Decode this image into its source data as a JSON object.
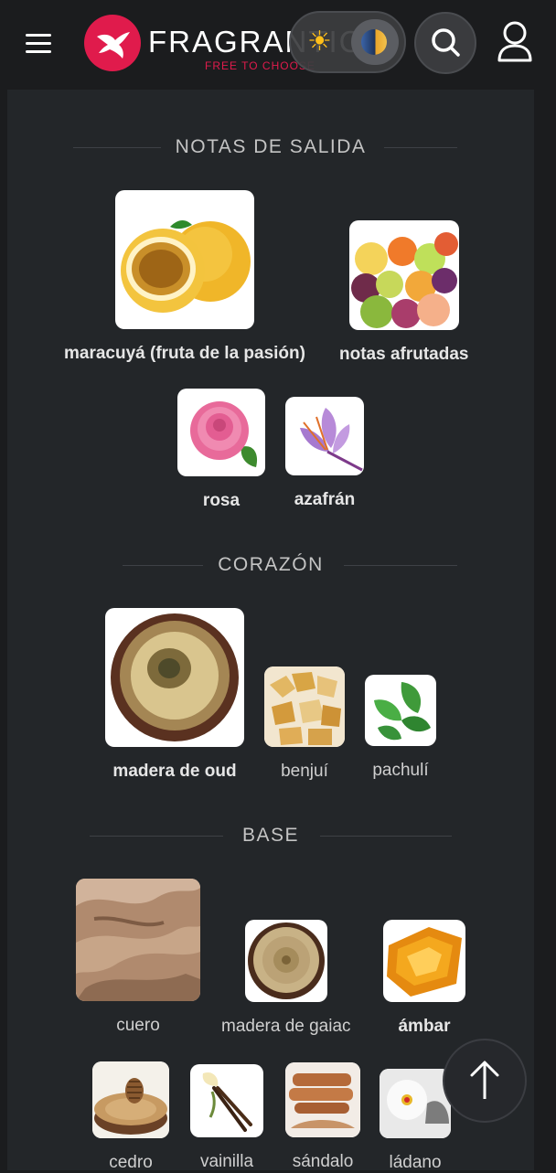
{
  "header": {
    "logo_text": "FRAGRANTICA",
    "tagline": "FREE TO CHOOSE",
    "menu_icon": "hamburger-icon",
    "theme_icons": [
      "sun-icon",
      "moon-icon"
    ],
    "search_icon": "search-icon",
    "user_icon": "user-icon"
  },
  "sections": {
    "top": {
      "title": "NOTAS DE SALIDA",
      "notes": [
        "maracuyá (fruta de la pasión)",
        "notas afrutadas",
        "rosa",
        "azafrán"
      ]
    },
    "heart": {
      "title": "CORAZÓN",
      "notes": [
        "madera de oud",
        "benjuí",
        "pachulí"
      ]
    },
    "base": {
      "title": "BASE",
      "notes": [
        "cuero",
        "madera de gaiac",
        "ámbar",
        "cedro",
        "vainilla",
        "sándalo",
        "ládano"
      ]
    }
  },
  "scroll_top_icon": "arrow-up-icon",
  "colors": {
    "brand": "#e01b4c",
    "background": "#1b1c1e",
    "panel": "#232629"
  }
}
